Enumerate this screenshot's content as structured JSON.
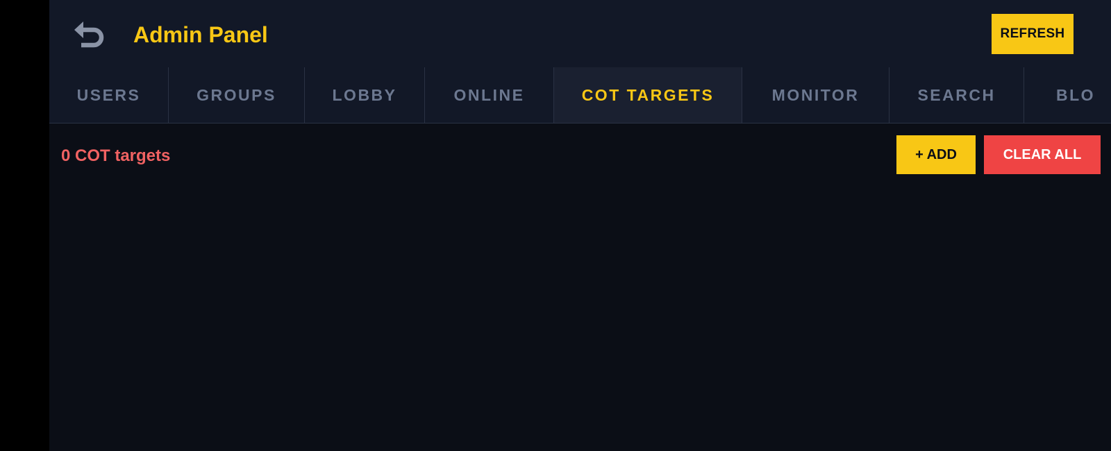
{
  "header": {
    "title": "Admin Panel",
    "back_icon": "undo-arrow-icon",
    "refresh_label": "REFRESH"
  },
  "tabs": [
    {
      "label": "USERS",
      "active": false
    },
    {
      "label": "GROUPS",
      "active": false
    },
    {
      "label": "LOBBY",
      "active": false
    },
    {
      "label": "ONLINE",
      "active": false
    },
    {
      "label": "COT TARGETS",
      "active": true
    },
    {
      "label": "MONITOR",
      "active": false
    },
    {
      "label": "SEARCH",
      "active": false
    },
    {
      "label": "BLO",
      "active": false
    }
  ],
  "toolbar": {
    "count_text": "0 COT targets",
    "add_label": "+ ADD",
    "clear_all_label": "CLEAR ALL"
  },
  "colors": {
    "accent": "#f8c715",
    "danger": "#ef4444",
    "count_text": "#f06262",
    "background": "#0b0e16",
    "header": "#121827"
  }
}
